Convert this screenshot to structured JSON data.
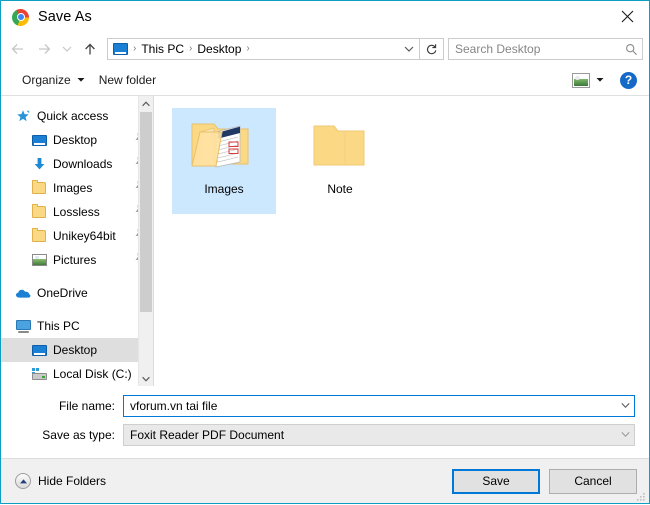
{
  "window": {
    "title": "Save As",
    "app_icon": "chrome-icon",
    "close_label": "✕",
    "border_color": "#0d9ec4"
  },
  "nav": {
    "back": "back-arrow",
    "forward": "forward-arrow",
    "recent": "recent-locations-chevron",
    "up": "up-arrow",
    "breadcrumb": {
      "root_icon": "this-pc-monitor-icon",
      "items": [
        "This PC",
        "Desktop"
      ],
      "separator": "›"
    },
    "address_dropdown": "chevron-down-icon",
    "refresh": "refresh-icon",
    "search": {
      "placeholder": "Search Desktop",
      "icon": "search-icon"
    }
  },
  "commandbar": {
    "organize": "Organize",
    "organize_caret": "▾",
    "new_folder": "New folder",
    "view_icon": "change-view-icon",
    "view_caret": "▾",
    "help": "?"
  },
  "sidebar": {
    "groups": [
      {
        "label": "Quick access",
        "icon": "quick-access-star-icon",
        "level": 0,
        "selected": false,
        "pinned": false
      },
      {
        "label": "Desktop",
        "icon": "monitor-icon",
        "level": 1,
        "selected": false,
        "pinned": true
      },
      {
        "label": "Downloads",
        "icon": "downloads-arrow-icon",
        "level": 1,
        "selected": false,
        "pinned": true
      },
      {
        "label": "Images",
        "icon": "folder-icon",
        "level": 1,
        "selected": false,
        "pinned": true
      },
      {
        "label": "Lossless",
        "icon": "folder-icon",
        "level": 1,
        "selected": false,
        "pinned": true
      },
      {
        "label": "Unikey64bit",
        "icon": "folder-icon",
        "level": 1,
        "selected": false,
        "pinned": true
      },
      {
        "label": "Pictures",
        "icon": "pictures-icon",
        "level": 1,
        "selected": false,
        "pinned": true
      },
      {
        "label": "OneDrive",
        "icon": "onedrive-cloud-icon",
        "level": 0,
        "selected": false,
        "pinned": false
      },
      {
        "label": "This PC",
        "icon": "this-pc-icon",
        "level": 0,
        "selected": false,
        "pinned": false
      },
      {
        "label": "Desktop",
        "icon": "monitor-icon",
        "level": 1,
        "selected": true,
        "pinned": false
      },
      {
        "label": "Local Disk (C:)",
        "icon": "local-disk-icon",
        "level": 1,
        "selected": false,
        "pinned": false
      }
    ],
    "scrollbar": {
      "up": "▴",
      "down": "▾"
    }
  },
  "files": [
    {
      "name": "Images",
      "icon": "open-folder-with-document-thumbnail",
      "selected": true
    },
    {
      "name": "Note",
      "icon": "closed-folder-icon",
      "selected": false
    }
  ],
  "form": {
    "filename_label": "File name:",
    "filename_value": "vforum.vn tai file",
    "filetype_label": "Save as type:",
    "filetype_value": "Foxit Reader PDF Document",
    "dropdown_icon": "chevron-down-icon"
  },
  "footer": {
    "hide_folders": "Hide Folders",
    "hide_folders_icon": "collapse-up-icon",
    "save": "Save",
    "cancel": "Cancel",
    "resize_grip": "resize-grip"
  }
}
